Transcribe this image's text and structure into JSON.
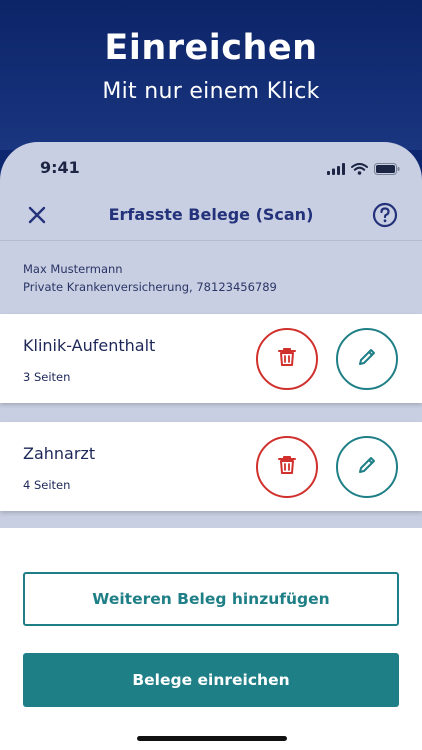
{
  "hero": {
    "title": "Einreichen",
    "subtitle": "Mit nur einem Klick"
  },
  "status_bar": {
    "time": "9:41",
    "icons": [
      "signal-icon",
      "wifi-icon",
      "battery-icon"
    ]
  },
  "nav": {
    "title": "Erfasste Belege (Scan)",
    "close_icon": "close-icon",
    "help_icon": "help-icon"
  },
  "user": {
    "name": "Max Mustermann",
    "insurance": "Private Krankenversicherung, 78123456789"
  },
  "documents": [
    {
      "title": "Klinik-Aufenthalt",
      "pages": "3 Seiten"
    },
    {
      "title": "Zahnarzt",
      "pages": "4 Seiten"
    }
  ],
  "actions": {
    "add_label": "Weiteren Beleg hinzufügen",
    "submit_label": "Belege einreichen"
  },
  "colors": {
    "brand_navy": "#0d2670",
    "accent_teal": "#1f7f86",
    "delete_red": "#d0312d"
  }
}
